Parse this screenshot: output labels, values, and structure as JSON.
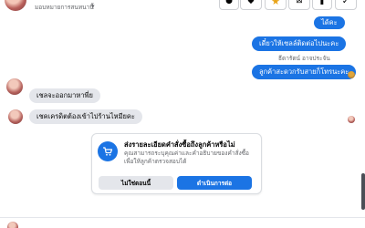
{
  "header": {
    "status_text": "มอบหมายการสนทนานี้",
    "chevron_icon": "chevron-down-icon",
    "toolbar": [
      {
        "name": "info-button",
        "icon": "info-icon",
        "glyph": "●"
      },
      {
        "name": "label-button",
        "icon": "tag-icon",
        "glyph": "◆"
      },
      {
        "name": "star-button",
        "icon": "star-icon",
        "glyph": "★"
      },
      {
        "name": "spam-button",
        "icon": "spam-icon",
        "glyph": "✕"
      },
      {
        "name": "mark-unread-button",
        "icon": "mail-icon",
        "glyph": "⬛"
      },
      {
        "name": "done-button",
        "icon": "check-icon",
        "glyph": "✓"
      }
    ]
  },
  "messages": {
    "out_top": "ได้คะ",
    "out_1": "เดี๋ยวให้เซลล์ติดต่อไปนะคะ",
    "sender": "ธีดารัตน์ อาจประจัน",
    "out_2": "ลูกค้าสะดวกรับสายก็โทรนะคะ",
    "in_1": "เชลจะออกมาหาพี่ย",
    "in_2": "เชคเครดิตต้องเข้าไปร้านไหมียคะ"
  },
  "card": {
    "icon": "cart-icon",
    "title": "ส่งรายละเอียดคำสั่งซื้อถึงลูกค้าหรือไม่",
    "description": "คุณสามารถระบุคุณค่าและคำอธิบายของคำสั่งซื้อเพื่อให้ลูกค้าตรวจสอบได้",
    "secondary_label": "ไม่ใช่ตอนนี้",
    "primary_label": "ดำเนินการต่อ"
  },
  "colors": {
    "accent": "#1b74e4",
    "incoming_bubble": "#e4e6eb",
    "secondary_text": "#65676b"
  }
}
